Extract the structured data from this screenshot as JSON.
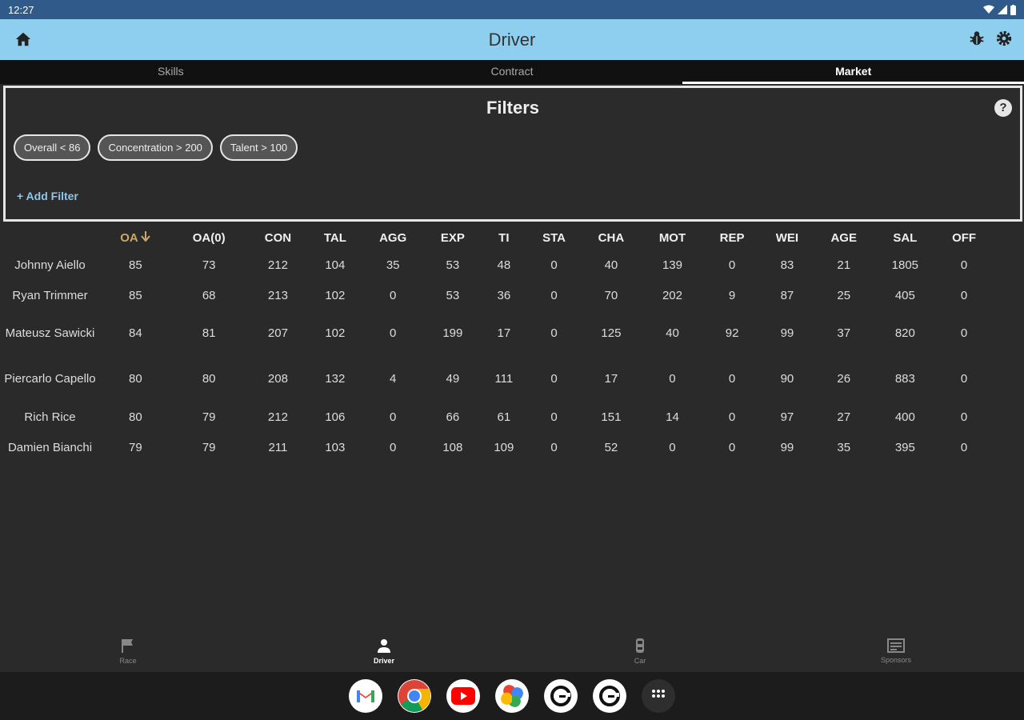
{
  "status": {
    "time": "12:27"
  },
  "appbar": {
    "title": "Driver"
  },
  "tabs": [
    {
      "label": "Skills"
    },
    {
      "label": "Contract"
    },
    {
      "label": "Market",
      "active": true
    }
  ],
  "filters": {
    "title": "Filters",
    "help": "?",
    "chips": [
      "Overall < 86",
      "Concentration > 200",
      "Talent > 100"
    ],
    "add_label": "+ Add Filter"
  },
  "table": {
    "columns": [
      "OA",
      "OA(0)",
      "CON",
      "TAL",
      "AGG",
      "EXP",
      "TI",
      "STA",
      "CHA",
      "MOT",
      "REP",
      "WEI",
      "AGE",
      "SAL",
      "OFF"
    ],
    "sorted_column": "OA",
    "rows": [
      {
        "name": "Johnny Aiello",
        "values": [
          "85",
          "73",
          "212",
          "104",
          "35",
          "53",
          "48",
          "0",
          "40",
          "139",
          "0",
          "83",
          "21",
          "1805",
          "0"
        ]
      },
      {
        "name": "Ryan Trimmer",
        "values": [
          "85",
          "68",
          "213",
          "102",
          "0",
          "53",
          "36",
          "0",
          "70",
          "202",
          "9",
          "87",
          "25",
          "405",
          "0"
        ]
      },
      {
        "name": "Mateusz Sawicki",
        "values": [
          "84",
          "81",
          "207",
          "102",
          "0",
          "199",
          "17",
          "0",
          "125",
          "40",
          "92",
          "99",
          "37",
          "820",
          "0"
        ]
      },
      {
        "name": "Piercarlo Capello",
        "values": [
          "80",
          "80",
          "208",
          "132",
          "4",
          "49",
          "111",
          "0",
          "17",
          "0",
          "0",
          "90",
          "26",
          "883",
          "0"
        ]
      },
      {
        "name": "Rich Rice",
        "values": [
          "80",
          "79",
          "212",
          "106",
          "0",
          "66",
          "61",
          "0",
          "151",
          "14",
          "0",
          "97",
          "27",
          "400",
          "0"
        ]
      },
      {
        "name": "Damien Bianchi",
        "values": [
          "79",
          "79",
          "211",
          "103",
          "0",
          "108",
          "109",
          "0",
          "52",
          "0",
          "0",
          "99",
          "35",
          "395",
          "0"
        ]
      }
    ]
  },
  "bottom_nav": [
    {
      "label": "Race",
      "icon": "flag-icon"
    },
    {
      "label": "Driver",
      "icon": "person-icon",
      "active": true
    },
    {
      "label": "Car",
      "icon": "car-icon"
    },
    {
      "label": "Sponsors",
      "icon": "sponsors-icon"
    }
  ],
  "dock": [
    "gmail-icon",
    "chrome-icon",
    "youtube-icon",
    "photos-icon",
    "game-app-icon",
    "game-app-icon-2",
    "app-drawer-icon"
  ]
}
